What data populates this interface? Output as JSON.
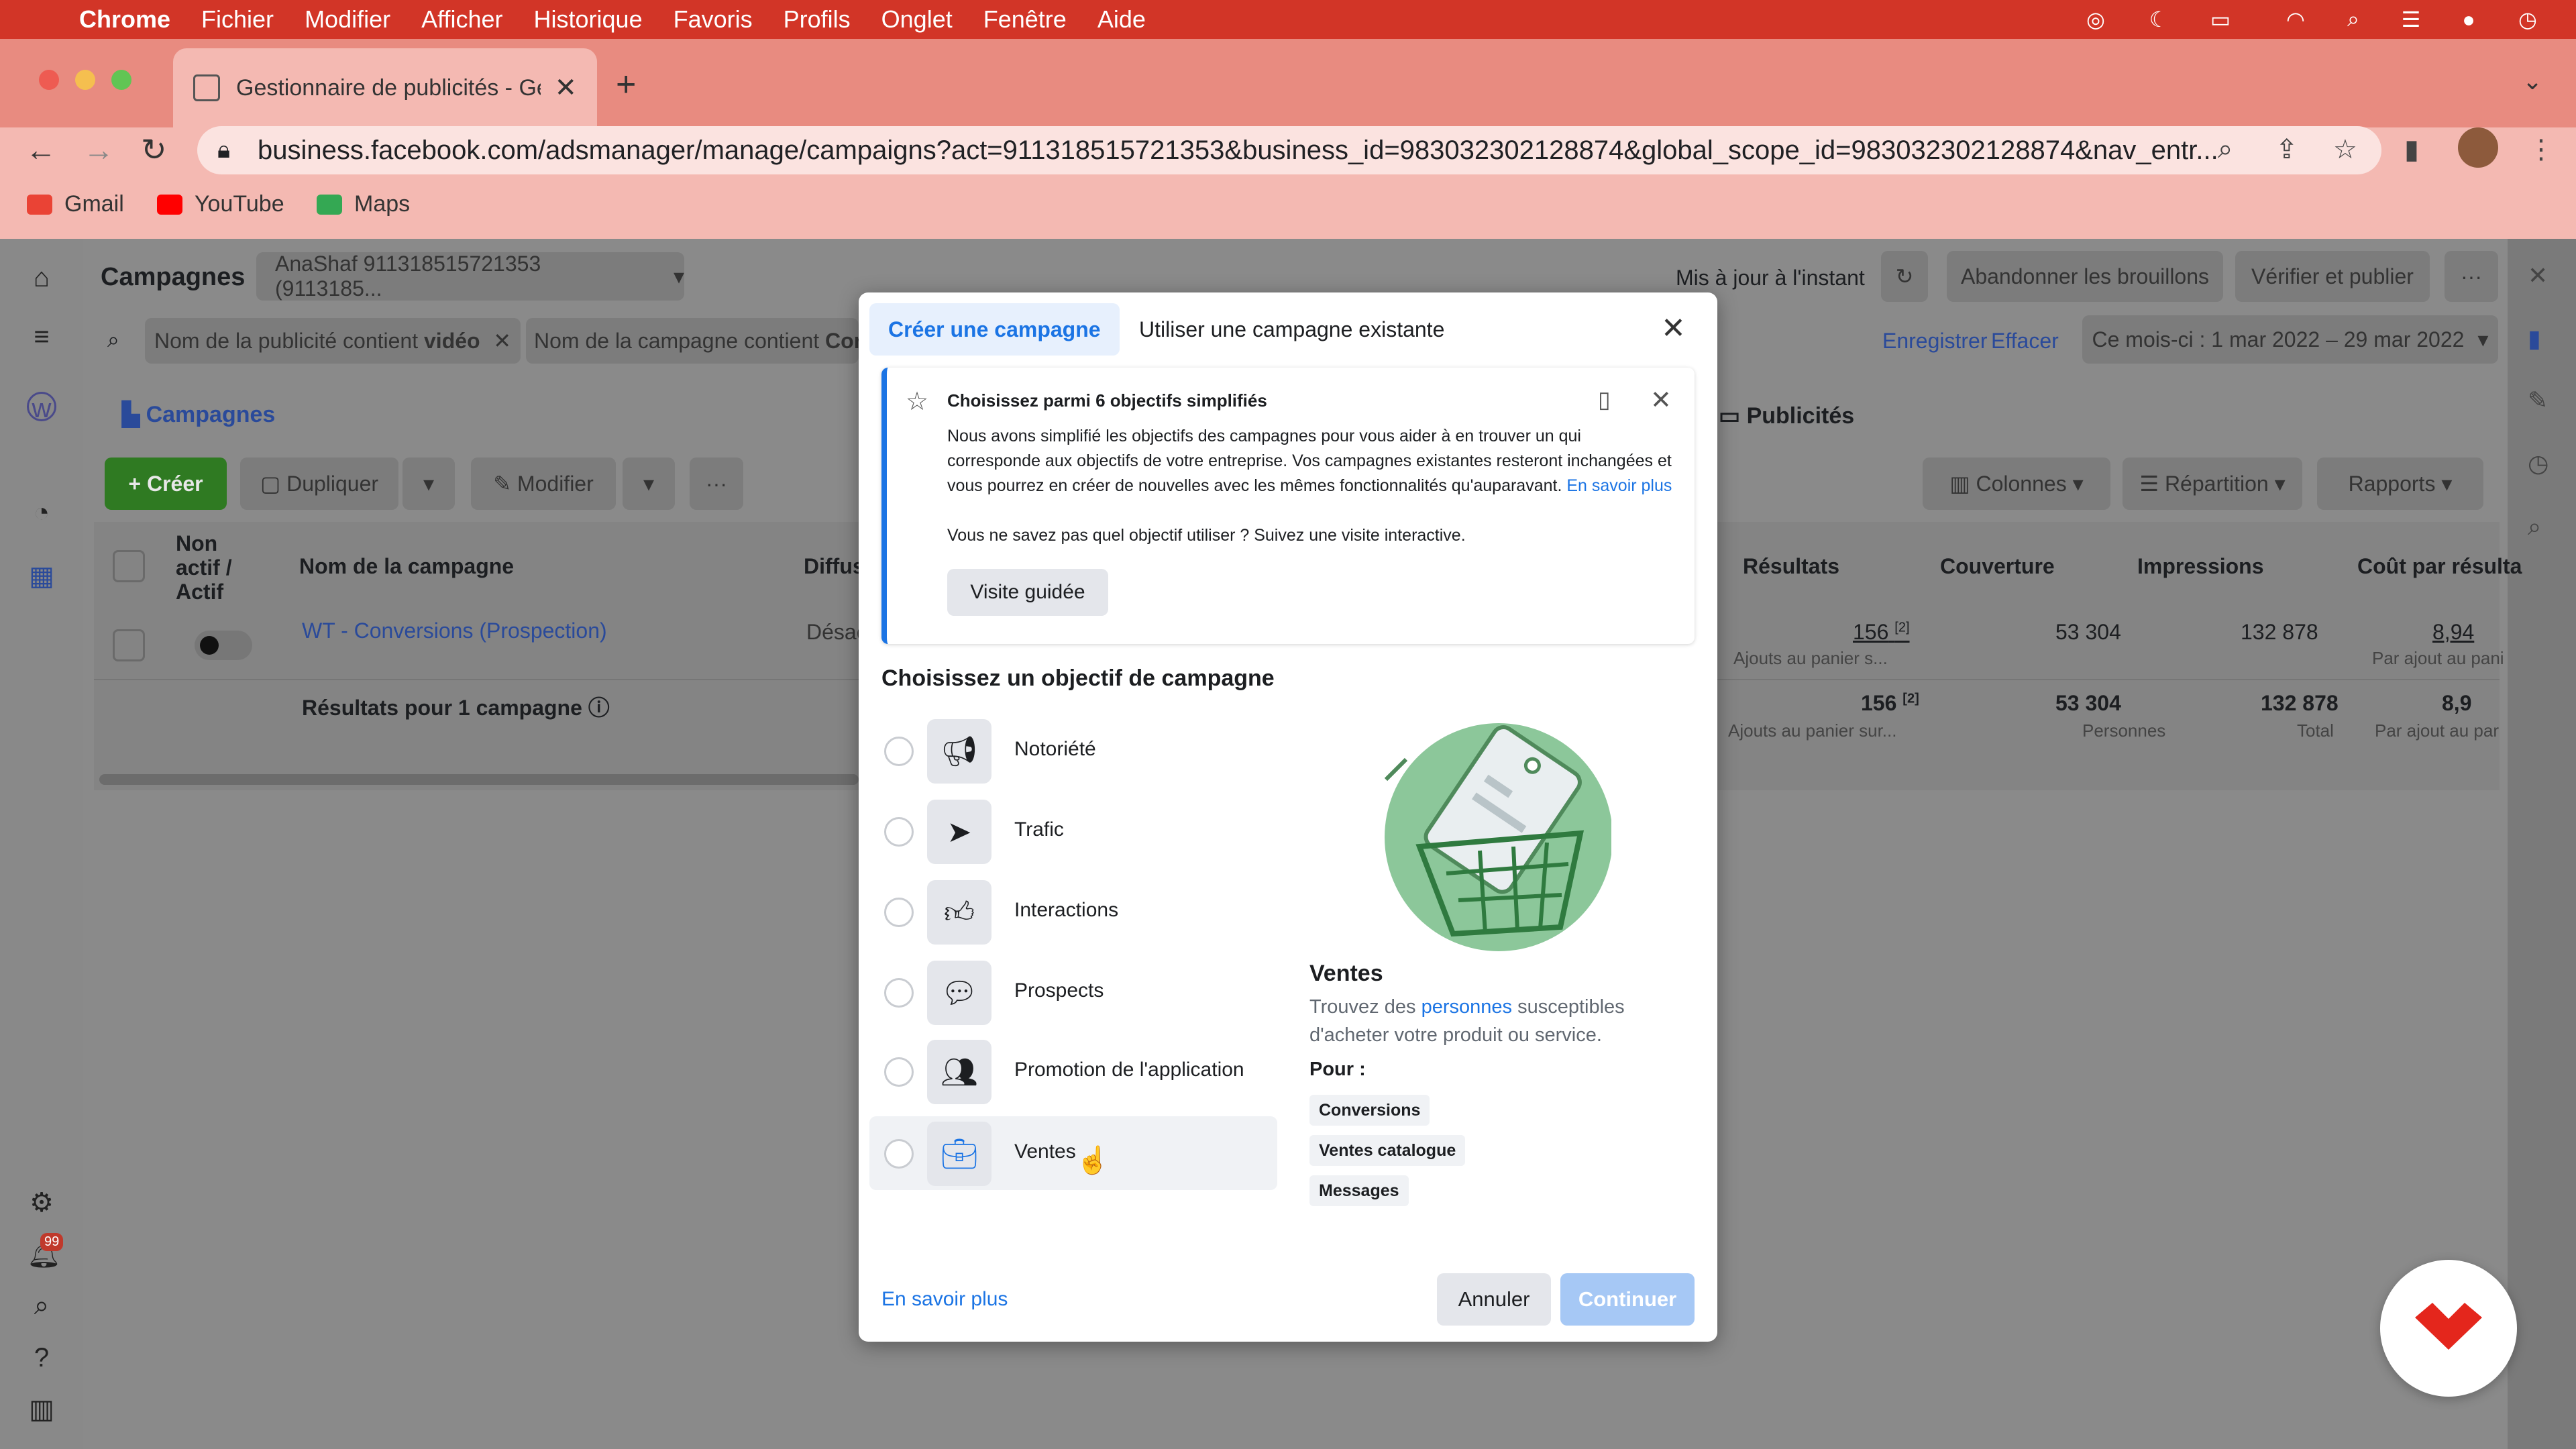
{
  "menubar": {
    "app": "Chrome",
    "items": [
      "Fichier",
      "Modifier",
      "Afficher",
      "Historique",
      "Favoris",
      "Profils",
      "Onglet",
      "Fenêtre",
      "Aide"
    ]
  },
  "browser": {
    "tab_title": "Gestionnaire de publicités - Gé",
    "url": "business.facebook.com/adsmanager/manage/campaigns?act=911318515721353&business_id=983032302128874&global_scope_id=983032302128874&nav_entr...",
    "bookmarks": [
      "Gmail",
      "YouTube",
      "Maps"
    ]
  },
  "page": {
    "section_title": "Campagnes",
    "account": "AnaShaf 911318515721353 (9113185...",
    "updated": "Mis à jour à l'instant",
    "discard_drafts": "Abandonner les brouillons",
    "verify_publish": "Vérifier et publier",
    "filter1_prefix": "Nom de la publicité contient",
    "filter1_value": "vidéo",
    "filter2_prefix": "Nom de la campagne contient",
    "filter2_value": "Conv",
    "save": "Enregistrer",
    "clear": "Effacer",
    "date_range": "Ce mois-ci : 1 mar 2022 – 29 mar 2022",
    "campaigns_tab": "Campagnes",
    "ads_tab": "Publicités",
    "create": "Créer",
    "duplicate": "Dupliquer",
    "edit": "Modifier",
    "columns": "Colonnes",
    "breakdown": "Répartition",
    "reports": "Rapports",
    "col_status_1": "Non",
    "col_status_2": "actif /",
    "col_status_3": "Actif",
    "col_name": "Nom de la campagne",
    "col_delivery": "Diffus",
    "col_results": "Résultats",
    "col_reach": "Couverture",
    "col_impressions": "Impressions",
    "col_cost": "Coût par résulta",
    "row_name": "WT - Conversions (Prospection)",
    "row_delivery": "Désac",
    "row_results": "156",
    "row_results_sup": "[2]",
    "row_results_sub": "Ajouts au panier s...",
    "row_reach": "53 304",
    "row_impressions": "132 878",
    "row_cost": "8,94",
    "row_cost_sub": "Par ajout au pani",
    "total_label": "Résultats pour 1 campagne",
    "total_results": "156",
    "total_results_sup": "[2]",
    "total_results_sub": "Ajouts au panier sur...",
    "total_reach": "53 304",
    "total_reach_sub": "Personnes",
    "total_impressions": "132 878",
    "total_impressions_sub": "Total",
    "total_cost": "8,9",
    "total_cost_sub": "Par ajout au par"
  },
  "modal": {
    "tab_create": "Créer une campagne",
    "tab_existing": "Utiliser une campagne existante",
    "info_title": "Choisissez parmi 6 objectifs simplifiés",
    "info_body": "Nous avons simplifié les objectifs des campagnes pour vous aider à en trouver un qui corresponde aux objectifs de votre entreprise. Vos campagnes existantes resteront inchangées et vous pourrez en créer de nouvelles avec les mêmes fonctionnalités qu'auparavant.",
    "info_link": "En savoir plus",
    "info_hint": "Vous ne savez pas quel objectif utiliser ? Suivez une visite interactive.",
    "info_button": "Visite guidée",
    "heading": "Choisissez un objectif de campagne",
    "objectives": [
      "Notoriété",
      "Trafic",
      "Interactions",
      "Prospects",
      "Promotion de l'application",
      "Ventes"
    ],
    "detail_title": "Ventes",
    "detail_desc_1": "Trouvez des",
    "detail_desc_hl": "personnes",
    "detail_desc_2": "susceptibles d'acheter votre produit ou service.",
    "detail_for": "Pour :",
    "detail_chips": [
      "Conversions",
      "Ventes catalogue",
      "Messages"
    ],
    "learn_more": "En savoir plus",
    "cancel": "Annuler",
    "continue": "Continuer"
  },
  "notifications_badge": "99",
  "colors": {
    "menubar": "#d23527",
    "accent": "#1b74e4",
    "create_green": "#42b72a"
  }
}
